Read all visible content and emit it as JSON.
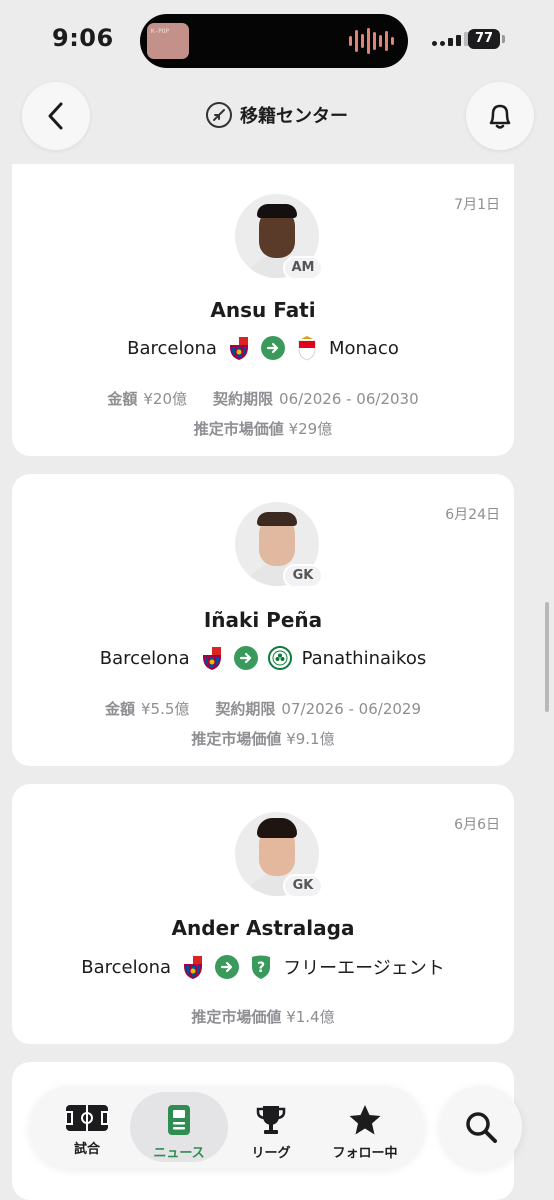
{
  "status": {
    "time": "9:06",
    "battery": "77",
    "island_label": "K-POP"
  },
  "header": {
    "title": "移籍センター",
    "back_icon": "chevron-left-icon",
    "bell_icon": "bell-icon"
  },
  "transfers": [
    {
      "date": "7月1日",
      "position": "AM",
      "name": "Ansu Fati",
      "from_club": "Barcelona",
      "to_club": "Monaco",
      "fee_label": "金額",
      "fee": "¥20億",
      "contract_label": "契約期限",
      "contract": "06/2026 - 06/2030",
      "market_label": "推定市場価値",
      "market_value": "¥29億"
    },
    {
      "date": "6月24日",
      "position": "GK",
      "name": "Iñaki Peña",
      "from_club": "Barcelona",
      "to_club": "Panathinaikos",
      "fee_label": "金額",
      "fee": "¥5.5億",
      "contract_label": "契約期限",
      "contract": "07/2026 - 06/2029",
      "market_label": "推定市場価値",
      "market_value": "¥9.1億"
    },
    {
      "date": "6月6日",
      "position": "GK",
      "name": "Ander Astralaga",
      "from_club": "Barcelona",
      "to_club": "フリーエージェント",
      "market_label": "推定市場価値",
      "market_value": "¥1.4億"
    }
  ],
  "tabs": [
    {
      "label": "試合",
      "icon": "pitch-icon"
    },
    {
      "label": "ニュース",
      "icon": "news-icon",
      "active": true
    },
    {
      "label": "リーグ",
      "icon": "trophy-icon"
    },
    {
      "label": "フォロー中",
      "icon": "star-icon"
    }
  ],
  "colors": {
    "accent": "#2f8c52",
    "arrow": "#3a9a5c",
    "background": "#ececec"
  }
}
